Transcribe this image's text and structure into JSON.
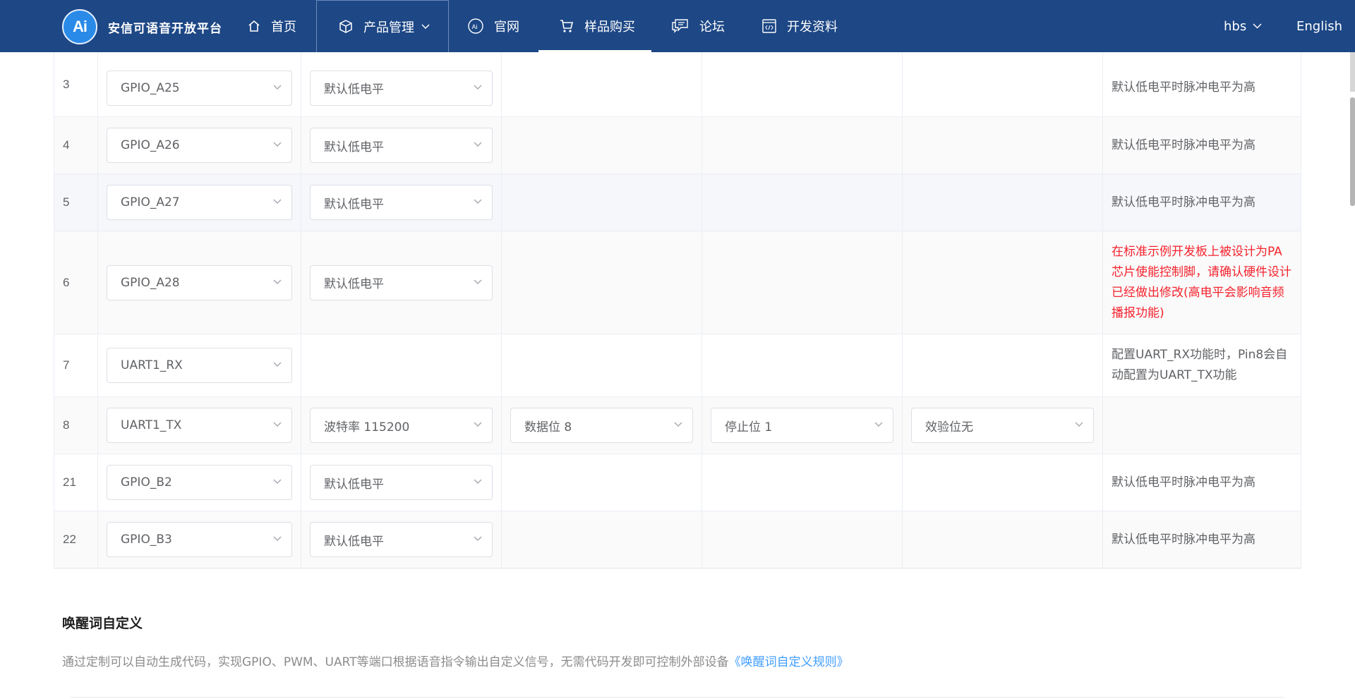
{
  "header": {
    "logo_text": "Ai",
    "brand": "安信可语音开放平台",
    "nav": [
      {
        "label": "首页",
        "icon": "home-icon"
      },
      {
        "label": "产品管理",
        "icon": "cube-icon"
      },
      {
        "label": "官网",
        "icon": "ai-circle-icon"
      },
      {
        "label": "样品购买",
        "icon": "cart-icon"
      },
      {
        "label": "论坛",
        "icon": "chat-icon"
      },
      {
        "label": "开发资料",
        "icon": "code-doc-icon"
      }
    ],
    "user": "hbs",
    "language": "English"
  },
  "table": {
    "rows": [
      {
        "pin": "3",
        "func": "GPIO_A25",
        "level": "默认低电平",
        "note": "默认低电平时脉冲电平为高"
      },
      {
        "pin": "4",
        "func": "GPIO_A26",
        "level": "默认低电平",
        "note": "默认低电平时脉冲电平为高"
      },
      {
        "pin": "5",
        "func": "GPIO_A27",
        "level": "默认低电平",
        "note": "默认低电平时脉冲电平为高"
      },
      {
        "pin": "6",
        "func": "GPIO_A28",
        "level": "默认低电平",
        "note": "在标准示例开发板上被设计为PA芯片使能控制脚，请确认硬件设计已经做出修改(高电平会影响音频播报功能)"
      },
      {
        "pin": "7",
        "func": "UART1_RX",
        "note": "配置UART_RX功能时，Pin8会自动配置为UART_TX功能"
      },
      {
        "pin": "8",
        "func": "UART1_TX",
        "baud": "波特率 115200",
        "data_bits": "数据位 8",
        "stop_bits": "停止位 1",
        "parity": "效验位无"
      },
      {
        "pin": "21",
        "func": "GPIO_B2",
        "level": "默认低电平",
        "note": "默认低电平时脉冲电平为高"
      },
      {
        "pin": "22",
        "func": "GPIO_B3",
        "level": "默认低电平",
        "note": "默认低电平时脉冲电平为高"
      }
    ]
  },
  "section": {
    "title": "唤醒词自定义",
    "desc": "通过定制可以自动生成代码，实现GPIO、PWM、UART等端口根据语音指令输出自定义信号，无需代码开发即可控制外部设备",
    "link": "《唤醒词自定义规则》"
  },
  "colors": {
    "header_bg": "#1d4785",
    "warn": "#f5222d",
    "link": "#409eff"
  }
}
